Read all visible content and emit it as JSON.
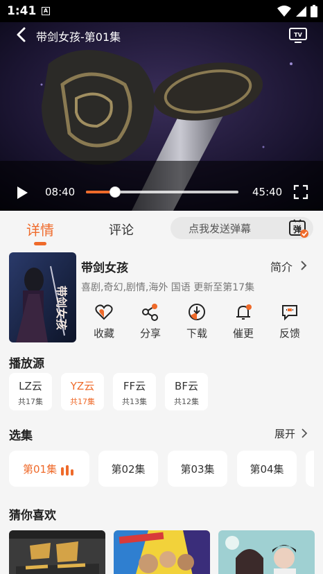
{
  "status_bar": {
    "time": "1:41",
    "notification_glyph": "A",
    "icons": [
      "wifi-icon",
      "signal-icon",
      "battery-icon"
    ]
  },
  "player": {
    "title": "带剑女孩-第01集",
    "current_time": "08:40",
    "total_time": "45:40",
    "progress_fraction": 0.19
  },
  "tabs": {
    "detail": "详情",
    "comments": "评论",
    "danmu_placeholder": "点我发送弹幕",
    "danmu_button": "弹"
  },
  "show": {
    "title": "带剑女孩",
    "intro_link": "简介",
    "tags": "喜剧,奇幻,剧情,海外 国语 更新至第17集",
    "poster_text": "带剑女孩"
  },
  "actions": [
    {
      "label": "收藏",
      "icon": "heart-icon"
    },
    {
      "label": "分享",
      "icon": "share-icon"
    },
    {
      "label": "下载",
      "icon": "download-icon"
    },
    {
      "label": "催更",
      "icon": "bell-icon"
    },
    {
      "label": "反馈",
      "icon": "feedback-icon"
    }
  ],
  "sources": {
    "title": "播放源",
    "items": [
      {
        "name": "LZ云",
        "count": "共17集",
        "active": false
      },
      {
        "name": "YZ云",
        "count": "共17集",
        "active": true
      },
      {
        "name": "FF云",
        "count": "共13集",
        "active": false
      },
      {
        "name": "BF云",
        "count": "共12集",
        "active": false
      }
    ]
  },
  "episodes": {
    "title": "选集",
    "expand": "展开",
    "items": [
      {
        "label": "第01集",
        "active": true
      },
      {
        "label": "第02集",
        "active": false
      },
      {
        "label": "第03集",
        "active": false
      },
      {
        "label": "第04集",
        "active": false
      }
    ]
  },
  "recommend": {
    "title": "猜你喜欢"
  },
  "colors": {
    "accent": "#ef6a2a",
    "background": "#f5f5f5"
  }
}
